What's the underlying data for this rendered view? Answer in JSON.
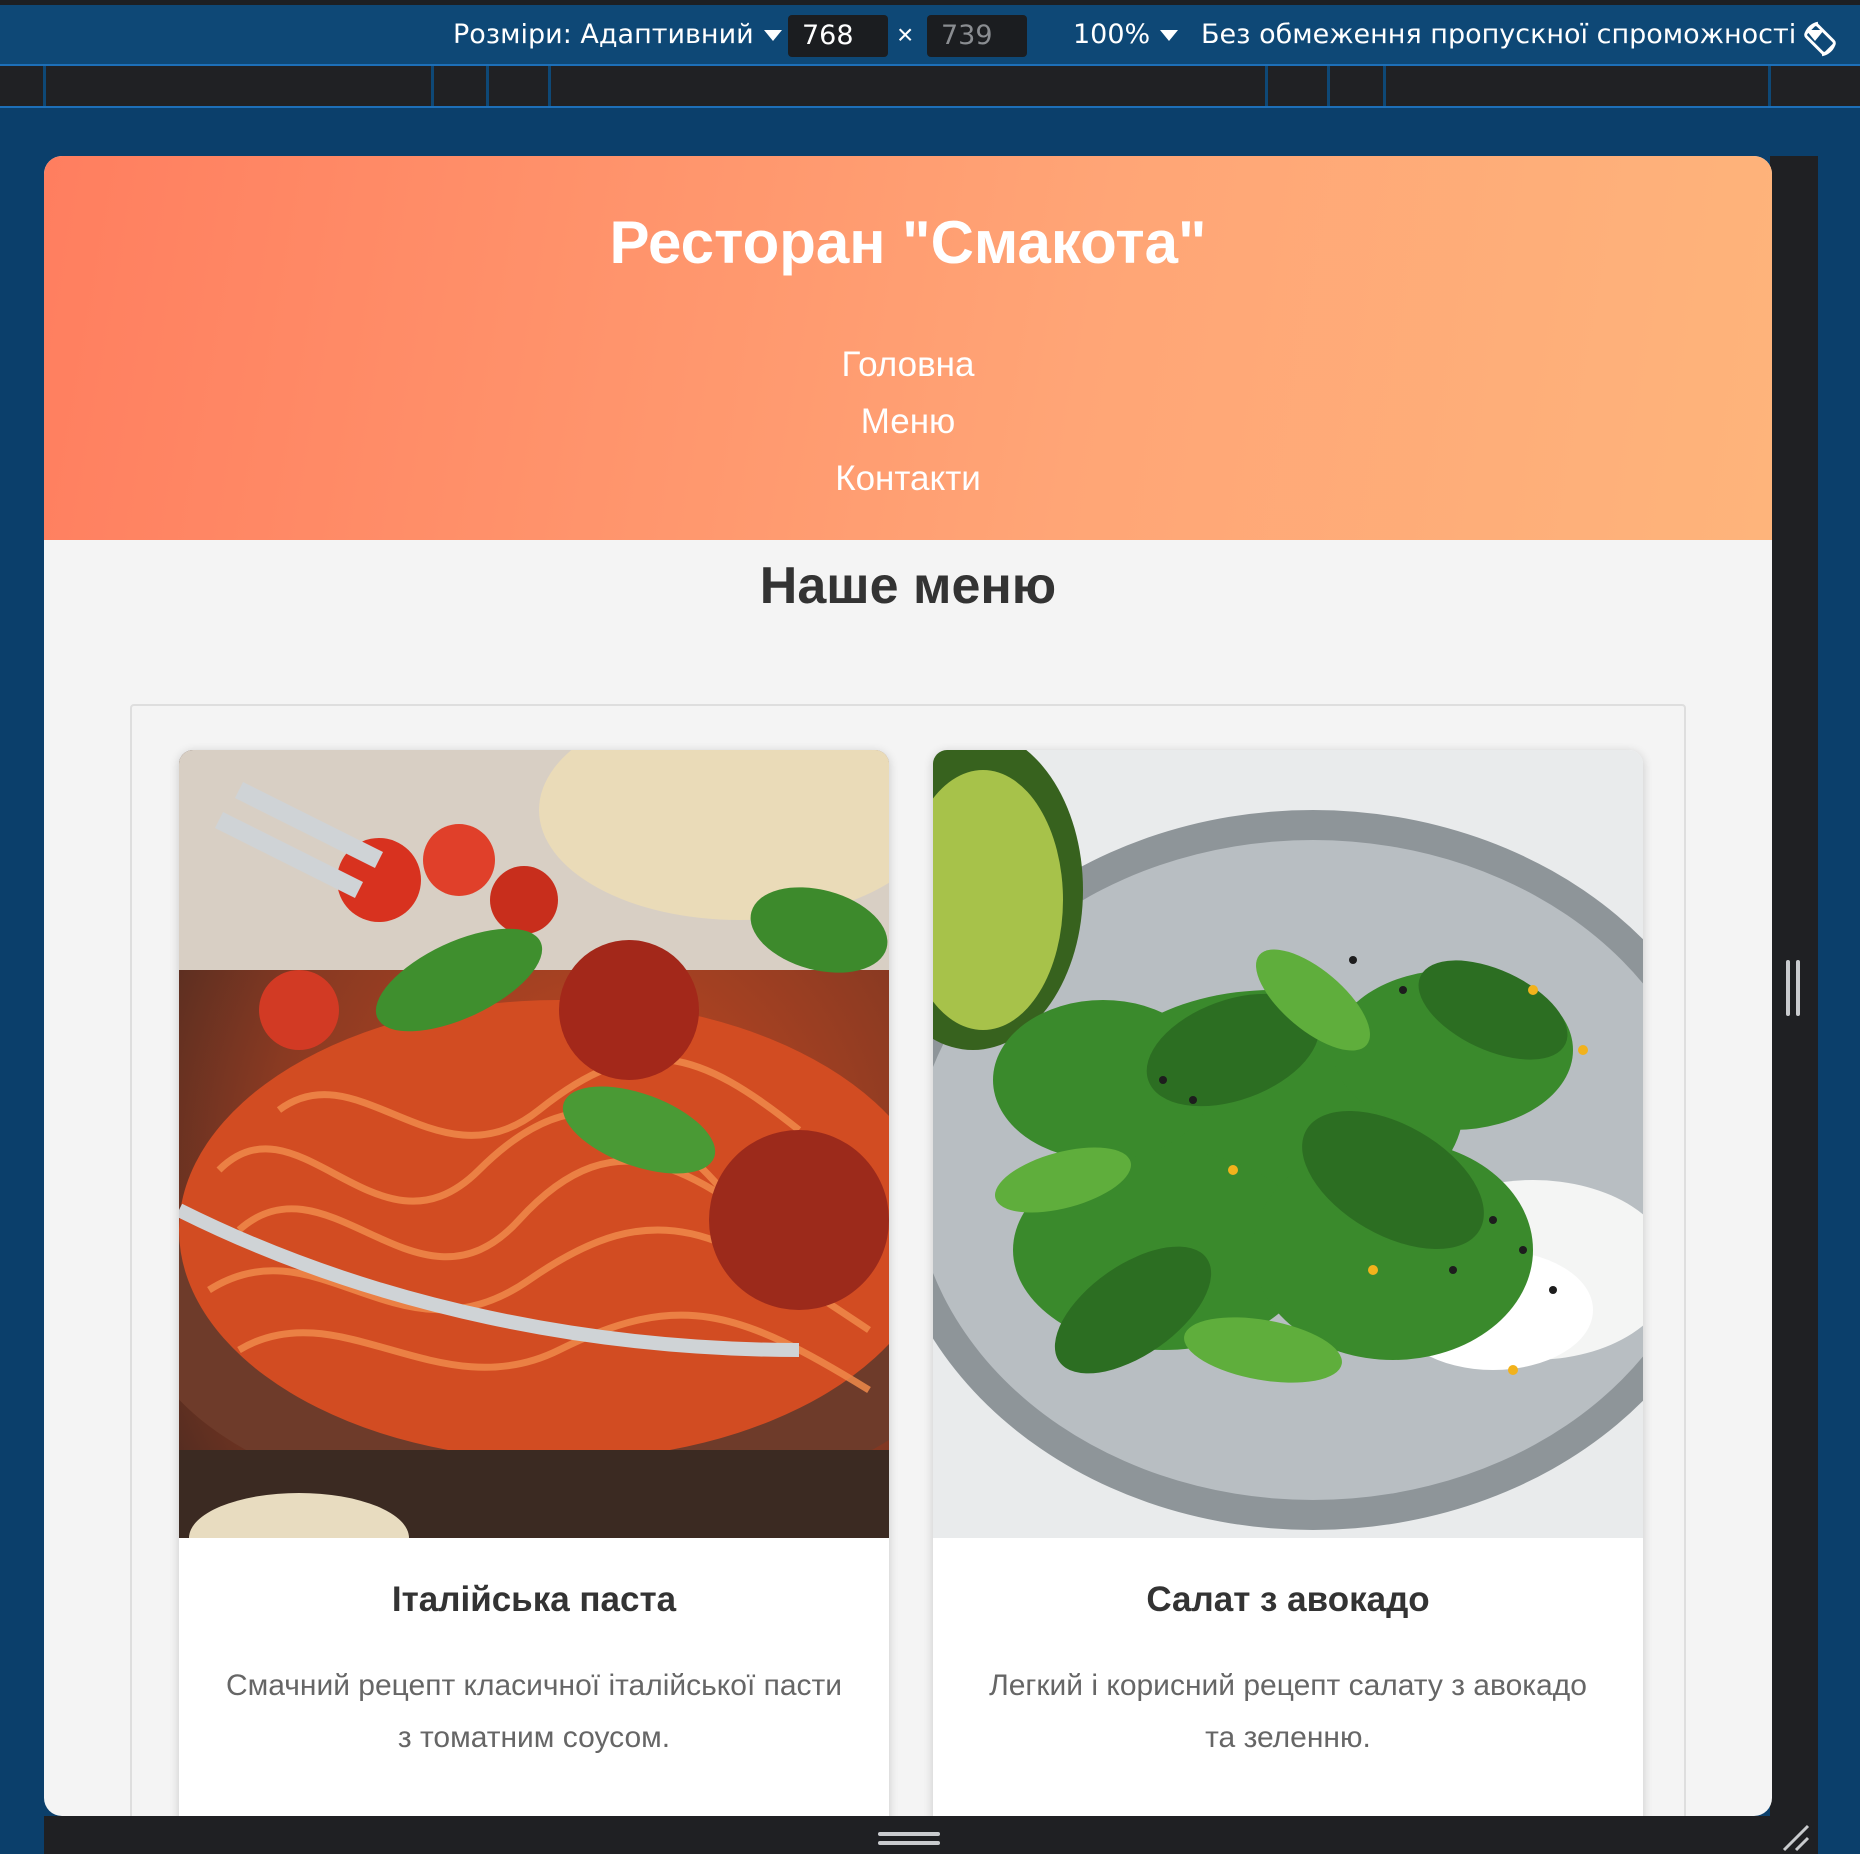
{
  "devtools": {
    "dimensions_label": "Розміри: Адаптивний",
    "width": "768",
    "height": "739",
    "times_sign": "×",
    "zoom": "100%",
    "throttling": "Без обмеження пропускної спроможності"
  },
  "site": {
    "title": "Ресторан \"Смакота\"",
    "nav": [
      "Головна",
      "Меню",
      "Контакти"
    ],
    "menu_heading": "Наше меню"
  },
  "cards": [
    {
      "title": "Італійська паста",
      "description": "Смачний рецепт класичної італійської пасти з томатним соусом."
    },
    {
      "title": "Салат з авокадо",
      "description": "Легкий і корисний рецепт салату з авокадо та зеленню."
    }
  ],
  "colors": {
    "header_gradient_start": "#ff7e5f",
    "header_gradient_end": "#feb47b",
    "page_background": "#f4f4f4",
    "devtools_blue": "#0e4876"
  }
}
